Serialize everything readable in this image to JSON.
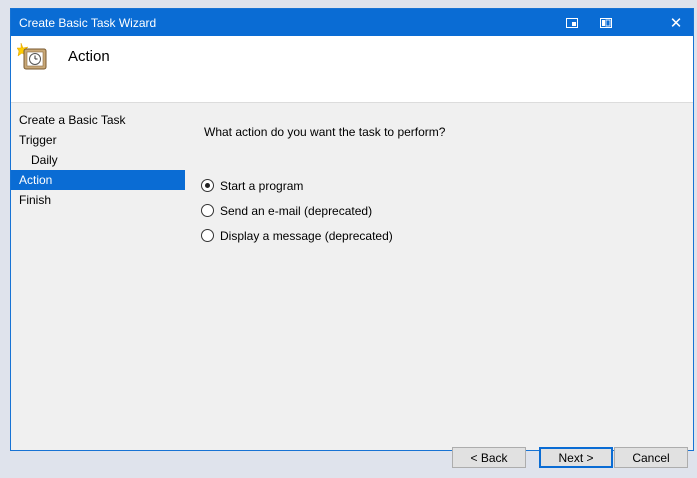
{
  "window": {
    "title": "Create Basic Task Wizard",
    "close_glyph": "✕"
  },
  "header": {
    "title": "Action",
    "icon": "task-clock-icon"
  },
  "nav": {
    "items": [
      {
        "label": "Create a Basic Task",
        "selected": false
      },
      {
        "label": "Trigger",
        "selected": false
      },
      {
        "label": "Daily",
        "selected": false
      },
      {
        "label": "Action",
        "selected": true
      },
      {
        "label": "Finish",
        "selected": false
      }
    ]
  },
  "content": {
    "question": "What action do you want the task to perform?",
    "options": [
      {
        "label": "Start a program",
        "checked": true
      },
      {
        "label": "Send an e-mail (deprecated)",
        "checked": false
      },
      {
        "label": "Display a message (deprecated)",
        "checked": false
      }
    ]
  },
  "buttons": {
    "back": "< Back",
    "next": "Next >",
    "cancel": "Cancel"
  },
  "colors": {
    "accent": "#0a6cd4",
    "window_bg": "#f0f0f0",
    "outer_bg": "#dfe3ec"
  }
}
